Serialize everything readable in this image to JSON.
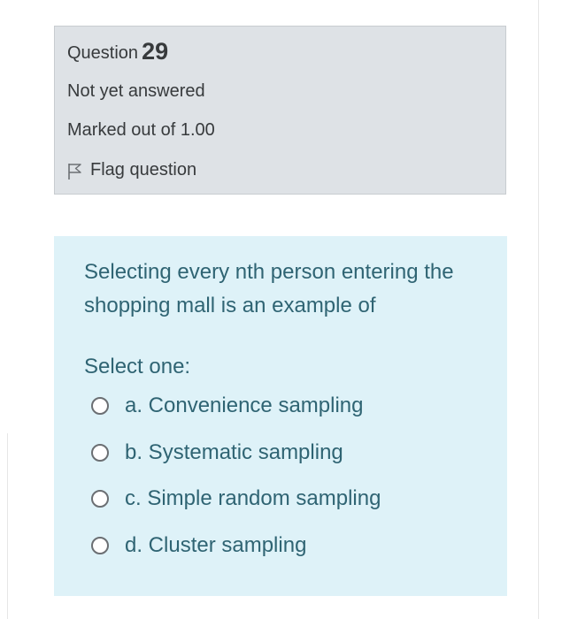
{
  "info": {
    "question_label": "Question",
    "question_number": "29",
    "state": "Not yet answered",
    "grade": "Marked out of 1.00",
    "flag_label": "Flag question",
    "flag_icon": "flag-outline-icon"
  },
  "question": {
    "text": "Selecting every nth person entering the shopping mall is an example of",
    "prompt": "Select one:",
    "options": [
      {
        "label": "a. Convenience sampling",
        "selected": false
      },
      {
        "label": "b. Systematic sampling",
        "selected": false
      },
      {
        "label": "c. Simple random sampling",
        "selected": false
      },
      {
        "label": "d. Cluster sampling",
        "selected": false
      }
    ]
  },
  "colors": {
    "info_background": "#dee2e6",
    "question_background": "#def2f8",
    "question_text": "#2f6473",
    "body_text": "#373a3c"
  }
}
